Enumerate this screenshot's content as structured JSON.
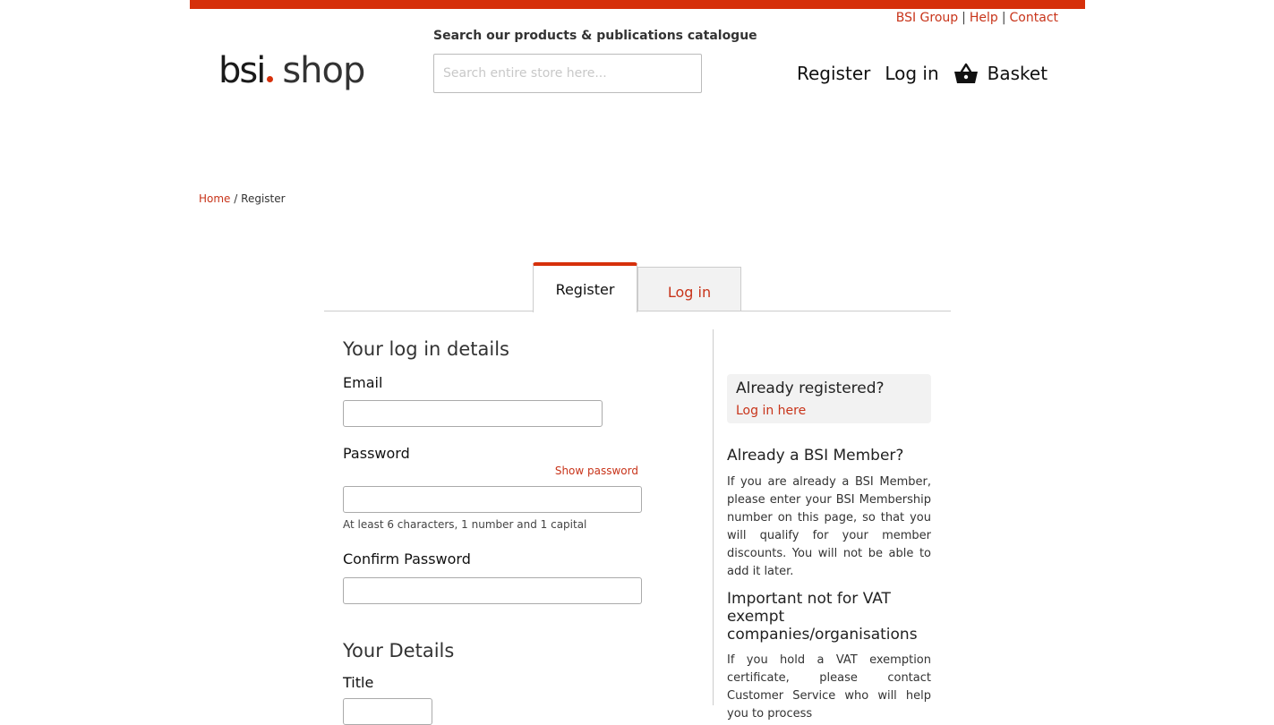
{
  "top_links": [
    "BSI Group",
    "Help",
    "Contact"
  ],
  "top_links_separator": "|",
  "logo": {
    "brand": "bsi",
    "shop": "shop"
  },
  "search": {
    "label": "Search our products & publications catalogue",
    "placeholder": "Search entire store here..."
  },
  "header_nav": {
    "register": "Register",
    "login": "Log in",
    "basket": "Basket"
  },
  "breadcrumb": {
    "home": "Home",
    "separator": "/",
    "current": "Register"
  },
  "tabs": {
    "register": "Register",
    "login": "Log in"
  },
  "form": {
    "login_heading": "Your log in details",
    "email_label": "Email",
    "password_label": "Password",
    "show_password": "Show password",
    "password_hint": "At least 6 characters, 1 number and 1 capital",
    "confirm_label": "Confirm Password",
    "details_heading": "Your Details",
    "title_label": "Title"
  },
  "sidebar": {
    "already_registered": "Already registered?",
    "login_here": "Log in here",
    "member_heading": "Already a BSI Member?",
    "member_text": "If you are already a BSI Member, please enter your BSI Membership number on this page, so that you will qualify for your member discounts. You will not be able to add it later.",
    "vat_heading": "Important not for VAT exempt companies/organisations",
    "vat_text": "If you hold a VAT exemption certificate, please contact Customer Service who will help you to process"
  },
  "colors": {
    "accent": "#d6300b",
    "link": "#c8341a"
  }
}
